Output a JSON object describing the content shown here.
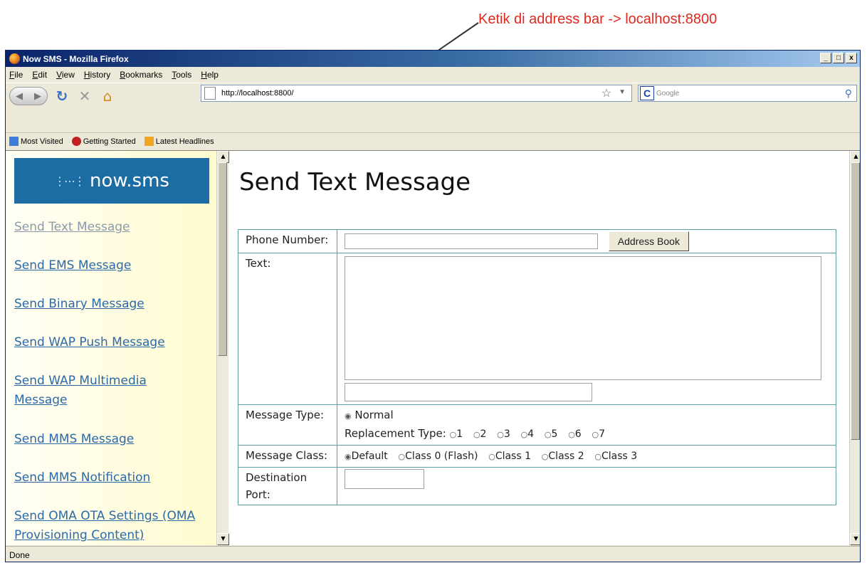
{
  "annotation": {
    "text": "Ketik di address bar -> localhost:8800",
    "color": "#e0281e"
  },
  "window": {
    "title": "Now SMS - Mozilla Firefox",
    "controls": [
      "_",
      "□",
      "x"
    ]
  },
  "menu": [
    "File",
    "Edit",
    "View",
    "History",
    "Bookmarks",
    "Tools",
    "Help"
  ],
  "toolbar": {
    "url": "http://localhost:8800/",
    "search_placeholder": "Google",
    "icons": [
      "back-icon",
      "forward-icon",
      "reload-icon",
      "stop-icon",
      "home-icon",
      "page-icon",
      "star-icon",
      "search-icon"
    ]
  },
  "bookmarks": [
    "Most Visited",
    "Getting Started",
    "Latest Headlines"
  ],
  "sidebar": {
    "logo_text": "now.sms",
    "links": [
      "Send Text Message",
      "Send EMS Message",
      "Send Binary Message",
      "Send WAP Push Message",
      "Send WAP Multimedia Message",
      "Send MMS Message",
      "Send MMS Notification",
      "Send OMA OTA Settings (OMA Provisioning Content)"
    ]
  },
  "main": {
    "heading": "Send Text Message",
    "phone_label": "Phone Number:",
    "address_book": "Address Book",
    "text_label": "Text:",
    "msg_type_label": "Message Type:",
    "normal_option": "Normal",
    "replacement_label": "Replacement Type:",
    "replacement_options": [
      "1",
      "2",
      "3",
      "4",
      "5",
      "6",
      "7"
    ],
    "msg_class_label": "Message Class:",
    "class_options": [
      "Default",
      "Class 0 (Flash)",
      "Class 1",
      "Class 2",
      "Class 3"
    ],
    "dest_port_label": "Destination Port:"
  },
  "status": "Done"
}
